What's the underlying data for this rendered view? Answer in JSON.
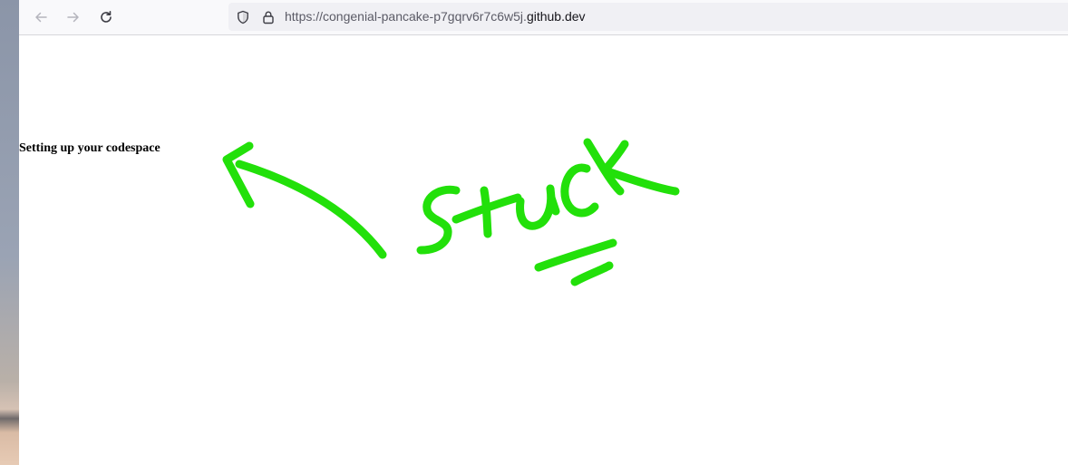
{
  "browser": {
    "url_prefix": "https://congenial-pancake-p7gqrv6r7c6w5j.",
    "url_domain": "github.dev",
    "back_icon": "arrow-left-icon",
    "forward_icon": "arrow-right-icon",
    "reload_icon": "reload-icon",
    "tracking_icon": "shield-icon",
    "lock_icon": "lock-icon"
  },
  "page": {
    "status_text": "Setting up your codespace"
  },
  "annotation": {
    "handwritten_text": "stuck",
    "color": "#22e00a"
  }
}
